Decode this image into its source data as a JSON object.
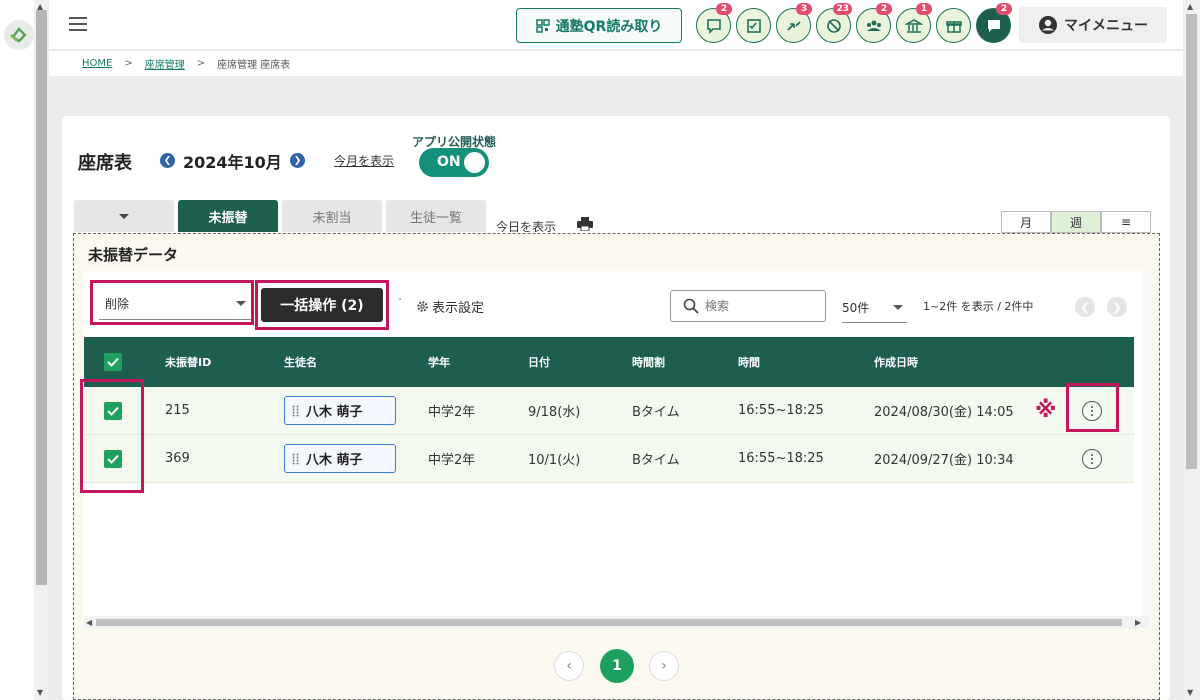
{
  "header": {
    "qr_button": "通塾QR読み取り",
    "my_menu": "マイメニュー",
    "icons": [
      {
        "name": "chat-icon",
        "badge": "2"
      },
      {
        "name": "checklist-icon",
        "badge": ""
      },
      {
        "name": "transfer-icon",
        "badge": "3"
      },
      {
        "name": "absence-icon",
        "badge": "23"
      },
      {
        "name": "group-icon",
        "badge": "2"
      },
      {
        "name": "school-icon",
        "badge": "1"
      },
      {
        "name": "gift-icon",
        "badge": ""
      },
      {
        "name": "message-icon",
        "badge": "2"
      }
    ]
  },
  "breadcrumb": {
    "home": "HOME",
    "seat_mgmt": "座席管理",
    "current": "座席管理 座席表",
    "sep": ">"
  },
  "page": {
    "title": "座席表",
    "month": "2024年10月",
    "show_month": "今月を表示",
    "app_status_label": "アプリ公開状態",
    "toggle_label": "ON",
    "show_today": "今日を表示"
  },
  "tabs": [
    "未振替",
    "未割当",
    "生徒一覧"
  ],
  "view_buttons": [
    "月",
    "週",
    "≡"
  ],
  "modal": {
    "title": "未振替データ",
    "action_value": "削除",
    "bulk_button": "一括操作 (2)",
    "display_settings": "表示設定",
    "search_placeholder": "検索",
    "per_page": "50件",
    "range": "1~2件 を表示 / 2件中",
    "current_page": "1"
  },
  "table": {
    "columns": [
      "未振替ID",
      "生徒名",
      "学年",
      "日付",
      "時間割",
      "時間",
      "作成日時"
    ],
    "rows": [
      {
        "id": "215",
        "student": "八木 萌子",
        "grade": "中学2年",
        "date": "9/18(水)",
        "period": "Bタイム",
        "time": "16:55~18:25",
        "created": "2024/08/30(金) 14:05",
        "note": "※"
      },
      {
        "id": "369",
        "student": "八木 萌子",
        "grade": "中学2年",
        "date": "10/1(火)",
        "period": "Bタイム",
        "time": "16:55~18:25",
        "created": "2024/09/27(金) 10:34",
        "note": ""
      }
    ]
  },
  "colors": {
    "primary": "#1d5e4f",
    "accent_green": "#1ea15f",
    "highlight": "#c2185b",
    "badge": "#e54d6e"
  }
}
